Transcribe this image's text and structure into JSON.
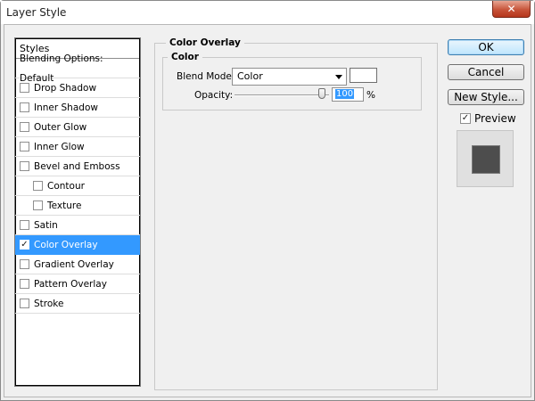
{
  "window": {
    "title": "Layer Style",
    "close_glyph": "✕"
  },
  "styles_panel": {
    "header": "Styles",
    "blending_options": "Blending Options: Default",
    "items": [
      {
        "label": "Drop Shadow",
        "checked": false,
        "sub": false,
        "selected": false
      },
      {
        "label": "Inner Shadow",
        "checked": false,
        "sub": false,
        "selected": false
      },
      {
        "label": "Outer Glow",
        "checked": false,
        "sub": false,
        "selected": false
      },
      {
        "label": "Inner Glow",
        "checked": false,
        "sub": false,
        "selected": false
      },
      {
        "label": "Bevel and Emboss",
        "checked": false,
        "sub": false,
        "selected": false
      },
      {
        "label": "Contour",
        "checked": false,
        "sub": true,
        "selected": false
      },
      {
        "label": "Texture",
        "checked": false,
        "sub": true,
        "selected": false
      },
      {
        "label": "Satin",
        "checked": false,
        "sub": false,
        "selected": false
      },
      {
        "label": "Color Overlay",
        "checked": true,
        "sub": false,
        "selected": true
      },
      {
        "label": "Gradient Overlay",
        "checked": false,
        "sub": false,
        "selected": false
      },
      {
        "label": "Pattern Overlay",
        "checked": false,
        "sub": false,
        "selected": false
      },
      {
        "label": "Stroke",
        "checked": false,
        "sub": false,
        "selected": false
      }
    ]
  },
  "color_overlay": {
    "group_title": "Color Overlay",
    "subgroup_title": "Color",
    "blend_mode_label": "Blend Mode:",
    "blend_mode_value": "Color",
    "overlay_color": "#ffffff",
    "opacity_label": "Opacity:",
    "opacity_value": "100",
    "opacity_unit": "%",
    "opacity_fraction": 1.0
  },
  "buttons": {
    "ok": "OK",
    "cancel": "Cancel",
    "new_style": "New Style..."
  },
  "preview": {
    "label": "Preview",
    "checked": true,
    "swatch_color": "#4d4d4d"
  },
  "colors": {
    "selection": "#3399ff",
    "dialog_bg": "#f0f0f0"
  }
}
